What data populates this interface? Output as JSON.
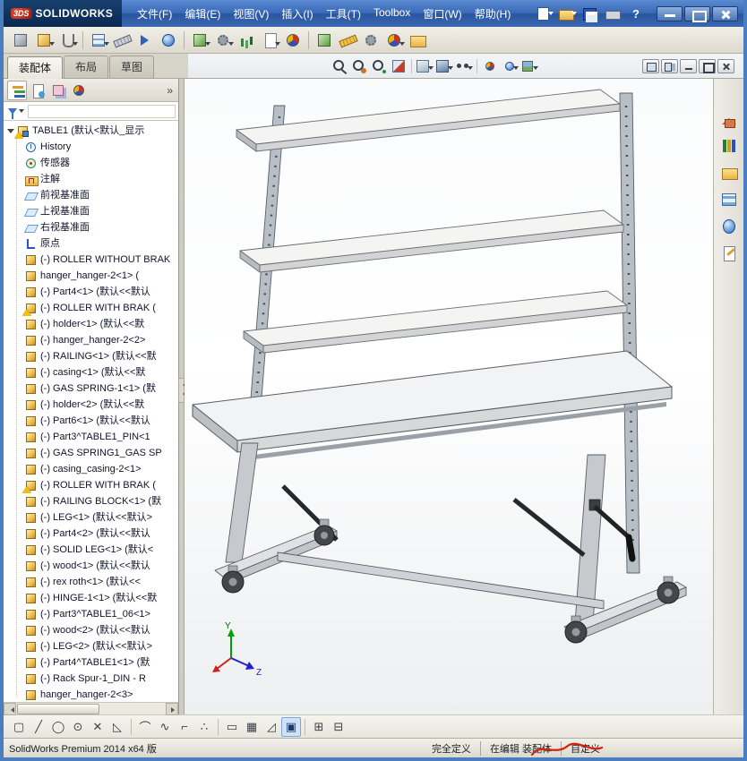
{
  "titlebar": {
    "logo_mark": "3DS",
    "logo_text": "SOLIDWORKS",
    "menus": [
      "文件(F)",
      "编辑(E)",
      "视图(V)",
      "插入(I)",
      "工具(T)",
      "Toolbox",
      "窗口(W)",
      "帮助(H)"
    ],
    "help_glyph": "?",
    "quick_icons": [
      "new-document-icon",
      "open-document-icon",
      "save-icon",
      "print-icon",
      "help-icon"
    ],
    "window_controls": [
      "minimize-button",
      "maximize-button",
      "close-button"
    ]
  },
  "toolbar": {
    "icons": [
      "edit-component",
      "insert-components",
      "mate",
      "linear-component-pattern",
      "smart-fasteners",
      "move-component",
      "show-hidden-components",
      "assembly-features",
      "reference-geometry",
      "new-motion-study",
      "bill-of-materials",
      "exploded-view",
      "interference-detection",
      "measure",
      "mass-properties",
      "appearances",
      "options"
    ]
  },
  "command_tabs": {
    "items": [
      {
        "label": "装配体",
        "active": true
      },
      {
        "label": "布局",
        "active": false
      },
      {
        "label": "草图",
        "active": false
      }
    ]
  },
  "headsup": {
    "icons": [
      "zoom-to-fit",
      "zoom-to-area",
      "previous-view",
      "section-view",
      "view-orientation",
      "display-style",
      "hide-show-items",
      "edit-appearance",
      "apply-scene",
      "view-settings"
    ]
  },
  "doc_window_controls": [
    "new-window-button",
    "tile-windows-button",
    "doc-minimize-button",
    "doc-restore-button",
    "doc-close-button"
  ],
  "panel": {
    "tabs": [
      "featuremanager-tab",
      "propertymanager-tab",
      "configurationmanager-tab",
      "displaymanager-tab"
    ],
    "chevron": "»",
    "filter_value": ""
  },
  "feature_tree": {
    "root": {
      "label": "TABLE1 (默认<默认_显示",
      "warning": true
    },
    "items": [
      {
        "icon": "history",
        "label": "History"
      },
      {
        "icon": "sensors",
        "label": "传感器"
      },
      {
        "icon": "annotations",
        "label": "注解"
      },
      {
        "icon": "plane",
        "label": "前视基准面"
      },
      {
        "icon": "plane",
        "label": "上视基准面"
      },
      {
        "icon": "plane",
        "label": "右视基准面"
      },
      {
        "icon": "origin",
        "label": "原点"
      },
      {
        "icon": "part",
        "label": "(-) ROLLER WITHOUT BRAK"
      },
      {
        "icon": "part",
        "label": "hanger_hanger-2<1> ("
      },
      {
        "icon": "part",
        "label": "(-) Part4<1> (默认<<默认"
      },
      {
        "icon": "part",
        "warning": true,
        "label": "(-) ROLLER WITH BRAK ("
      },
      {
        "icon": "part",
        "label": "(-) holder<1> (默认<<默"
      },
      {
        "icon": "part",
        "label": "(-) hanger_hanger-2<2>"
      },
      {
        "icon": "part",
        "label": "(-) RAILING<1> (默认<<默"
      },
      {
        "icon": "part",
        "label": "(-) casing<1> (默认<<默"
      },
      {
        "icon": "part",
        "label": "(-) GAS SPRING-1<1> (默"
      },
      {
        "icon": "part",
        "label": "(-) holder<2> (默认<<默"
      },
      {
        "icon": "part",
        "label": "(-) Part6<1> (默认<<默认"
      },
      {
        "icon": "part",
        "label": "(-) Part3^TABLE1_PIN<1"
      },
      {
        "icon": "part",
        "label": "(-) GAS SPRING1_GAS SP"
      },
      {
        "icon": "part",
        "label": "(-) casing_casing-2<1>"
      },
      {
        "icon": "part",
        "warning": true,
        "label": "(-) ROLLER WITH BRAK ("
      },
      {
        "icon": "part",
        "label": "(-) RAILING BLOCK<1> (默"
      },
      {
        "icon": "part",
        "label": "(-) LEG<1> (默认<<默认>"
      },
      {
        "icon": "part",
        "label": "(-) Part4<2> (默认<<默认"
      },
      {
        "icon": "part",
        "label": "(-) SOLID LEG<1> (默认<"
      },
      {
        "icon": "part",
        "label": "(-) wood<1> (默认<<默认"
      },
      {
        "icon": "part",
        "label": "(-) rex roth<1> (默认<<"
      },
      {
        "icon": "part",
        "label": "(-) HINGE-1<1> (默认<<默"
      },
      {
        "icon": "part",
        "label": "(-) Part3^TABLE1_06<1>"
      },
      {
        "icon": "part",
        "label": "(-) wood<2> (默认<<默认"
      },
      {
        "icon": "part",
        "label": "(-) LEG<2> (默认<<默认>"
      },
      {
        "icon": "part",
        "label": "(-) Part4^TABLE1<1> (默"
      },
      {
        "icon": "part",
        "label": "(-) Rack Spur-1_DIN - R"
      },
      {
        "icon": "part",
        "label": "hanger_hanger-2<3>"
      }
    ]
  },
  "viewport": {
    "model": "height-adjustable-workbench-assembly",
    "triad": {
      "y_label": "Y",
      "z_label": "Z"
    }
  },
  "taskpane": {
    "icons": [
      "home-icon",
      "design-library-icon",
      "file-explorer-icon",
      "view-palette-icon",
      "appearances-scenes-icon",
      "custom-properties-icon"
    ]
  },
  "snapbar": {
    "icons": [
      {
        "name": "select-snap-icon",
        "glyph": "▢"
      },
      {
        "name": "line-snap-icon",
        "glyph": "╱"
      },
      {
        "name": "circle-snap-icon",
        "glyph": "◯"
      },
      {
        "name": "point-snap-icon",
        "glyph": "⊙"
      },
      {
        "name": "cross-snap-icon",
        "glyph": "✕"
      },
      {
        "name": "triangle-snap-icon",
        "glyph": "◺"
      },
      {
        "name": "arc-snap-icon",
        "glyph": "⌒"
      },
      {
        "name": "spline-snap-icon",
        "glyph": "∿"
      },
      {
        "name": "corner-snap-icon",
        "glyph": "⌐"
      },
      {
        "name": "points-snap-icon",
        "glyph": "∴"
      },
      {
        "name": "slot-snap-icon",
        "glyph": "▭"
      },
      {
        "name": "grid-snap-icon",
        "glyph": "▦"
      },
      {
        "name": "angle-snap-icon",
        "glyph": "◿"
      },
      {
        "name": "shaded-view-icon",
        "glyph": "▣",
        "active": true
      },
      {
        "name": "grid-show-icon",
        "glyph": "⊞"
      },
      {
        "name": "grid-settings-icon",
        "glyph": "⊟"
      }
    ]
  },
  "statusbar": {
    "product": "SolidWorks Premium 2014 x64 版",
    "define_status": "完全定义",
    "edit_status": "在编辑 装配体",
    "custom": "自定义"
  },
  "colors": {
    "titlebar_blue": "#3a6ab8",
    "window_border": "#4a7ec0",
    "part_icon_gold": "#f0c050",
    "warning_yellow": "#f2c200",
    "snap_active_blue": "#cfe2f7"
  }
}
